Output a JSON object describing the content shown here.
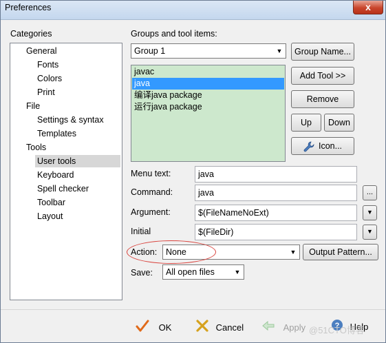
{
  "window": {
    "title": "Preferences",
    "close_glyph": "x"
  },
  "categories": {
    "heading": "Categories",
    "items": [
      {
        "label": "General",
        "level": 0
      },
      {
        "label": "Fonts",
        "level": 1
      },
      {
        "label": "Colors",
        "level": 1
      },
      {
        "label": "Print",
        "level": 1
      },
      {
        "label": "File",
        "level": 0
      },
      {
        "label": "Settings & syntax",
        "level": 1
      },
      {
        "label": "Templates",
        "level": 1
      },
      {
        "label": "Tools",
        "level": 0
      },
      {
        "label": "User tools",
        "level": 1,
        "selected": true
      },
      {
        "label": "Keyboard",
        "level": 1
      },
      {
        "label": "Spell checker",
        "level": 1
      },
      {
        "label": "Toolbar",
        "level": 1
      },
      {
        "label": "Layout",
        "level": 1
      }
    ]
  },
  "groups": {
    "heading": "Groups and tool items:",
    "selected_group": "Group 1",
    "group_name_button": "Group Name...",
    "add_tool_button": "Add Tool >>",
    "remove_button": "Remove",
    "up_button": "Up",
    "down_button": "Down",
    "icon_button": "Icon...",
    "tools": [
      {
        "label": "javac"
      },
      {
        "label": "java",
        "selected": true
      },
      {
        "label": "编译java package"
      },
      {
        "label": "运行java package"
      }
    ]
  },
  "form": {
    "menu_text_label": "Menu text:",
    "menu_text_value": "java",
    "command_label": "Command:",
    "command_value": "java",
    "command_browse": "...",
    "argument_label": "Argument:",
    "argument_value": "$(FileNameNoExt)",
    "initial_label": "Initial",
    "initial_value": "$(FileDir)",
    "action_label": "Action:",
    "action_value": "None",
    "output_pattern_button": "Output Pattern...",
    "save_label": "Save:",
    "save_value": "All open files"
  },
  "footer": {
    "ok": "OK",
    "cancel": "Cancel",
    "apply": "Apply",
    "help": "Help"
  },
  "watermark": "@51CTO博客",
  "colors": {
    "tool_list_bg": "#cde8cd",
    "selection": "#3399ff",
    "annotation_ellipse": "#d9423c",
    "ok_check": "#e06a1a",
    "cancel_x": "#d6a21e",
    "apply_arrow": "#9bc99b"
  }
}
